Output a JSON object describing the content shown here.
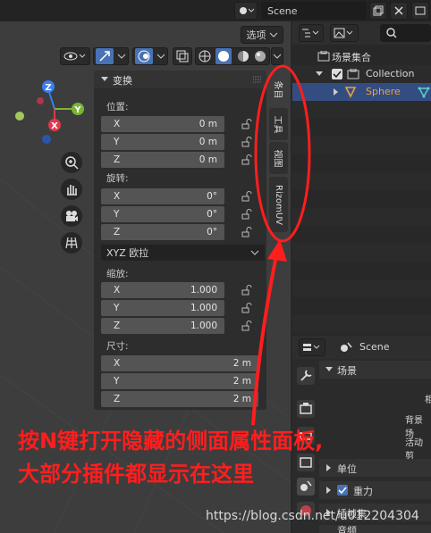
{
  "header": {
    "scene_label": "Scene",
    "options_label": "选项"
  },
  "npanel": {
    "title": "变换",
    "location_label": "位置:",
    "location": [
      {
        "axis": "X",
        "value": "0 m"
      },
      {
        "axis": "Y",
        "value": "0 m"
      },
      {
        "axis": "Z",
        "value": "0 m"
      }
    ],
    "rotation_label": "旋转:",
    "rotation": [
      {
        "axis": "X",
        "value": "0°"
      },
      {
        "axis": "Y",
        "value": "0°"
      },
      {
        "axis": "Z",
        "value": "0°"
      }
    ],
    "rotation_mode": "XYZ 欧拉",
    "scale_label": "缩放:",
    "scale": [
      {
        "axis": "X",
        "value": "1.000"
      },
      {
        "axis": "Y",
        "value": "1.000"
      },
      {
        "axis": "Z",
        "value": "1.000"
      }
    ],
    "dimensions_label": "尺寸:",
    "dimensions": [
      {
        "axis": "X",
        "value": "2 m"
      },
      {
        "axis": "Y",
        "value": "2 m"
      },
      {
        "axis": "Z",
        "value": "2 m"
      }
    ]
  },
  "tabs": [
    "条目",
    "工具",
    "视图",
    "RizomUV"
  ],
  "gizmo": {
    "x": "X",
    "y": "Y",
    "z": "Z"
  },
  "outliner": {
    "root": "场景集合",
    "collection": "Collection",
    "object": "Sphere"
  },
  "properties": {
    "scene_label": "Scene",
    "section_scene": "场景",
    "cut_1": "相",
    "cut_2": "背景场",
    "cut_3": "活动剪",
    "section_units": "单位",
    "gravity": "重力",
    "cut_keying": "插帧集",
    "cut_audio": "音频"
  },
  "annotation": {
    "line1": "按N键打开隐藏的侧面属性面板,",
    "line2": "大部分插件都显示在这里"
  },
  "watermark": "https://blog.csdn.net/u012204304",
  "colors": {
    "annotation": "#ff1e1e",
    "accent": "#4772b3",
    "axis_x": "#e0384c",
    "axis_y": "#7ab531",
    "axis_z": "#3a7ef0"
  }
}
